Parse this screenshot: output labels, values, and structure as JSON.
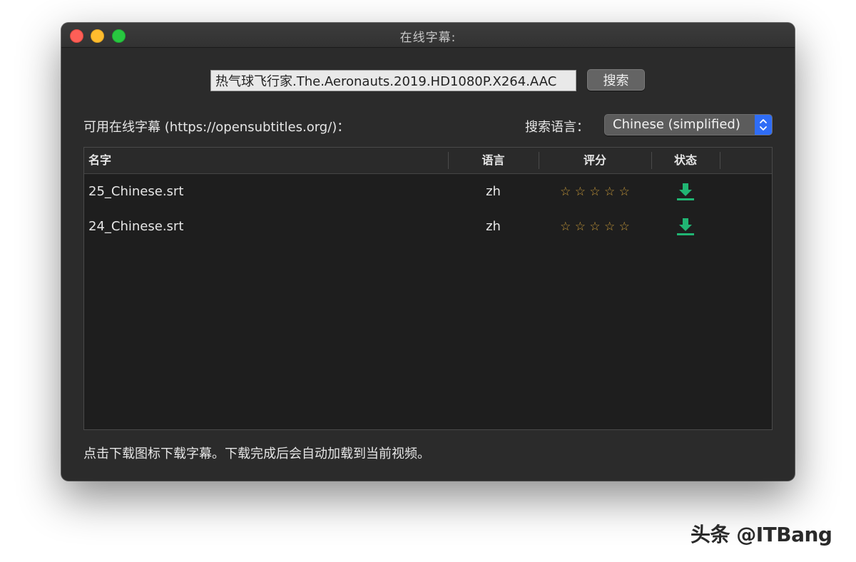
{
  "window": {
    "title": "在线字幕:"
  },
  "search": {
    "query": "热气球飞行家.The.Aeronauts.2019.HD1080P.X264.AAC",
    "button_label": "搜索"
  },
  "available_label": "可用在线字幕 (https://opensubtitles.org/)：",
  "language": {
    "label": "搜索语言：",
    "selected": "Chinese (simplified)"
  },
  "table": {
    "columns": {
      "name": "名字",
      "language": "语言",
      "rating": "评分",
      "status": "状态"
    },
    "rows": [
      {
        "name": "25_Chinese.srt",
        "lang": "zh",
        "stars": "☆ ☆ ☆ ☆ ☆"
      },
      {
        "name": "24_Chinese.srt",
        "lang": "zh",
        "stars": "☆ ☆ ☆ ☆ ☆"
      }
    ]
  },
  "footer_hint": "点击下载图标下载字幕。下载完成后会自动加载到当前视频。",
  "watermark": "头条 @ITBang",
  "icons": {
    "download": "download-icon",
    "star": "star-outline-icon",
    "select_arrows": "updown-chevron-icon"
  },
  "colors": {
    "download": "#21b573",
    "star": "#c89a3a",
    "select_accent": "#2f6df6"
  }
}
